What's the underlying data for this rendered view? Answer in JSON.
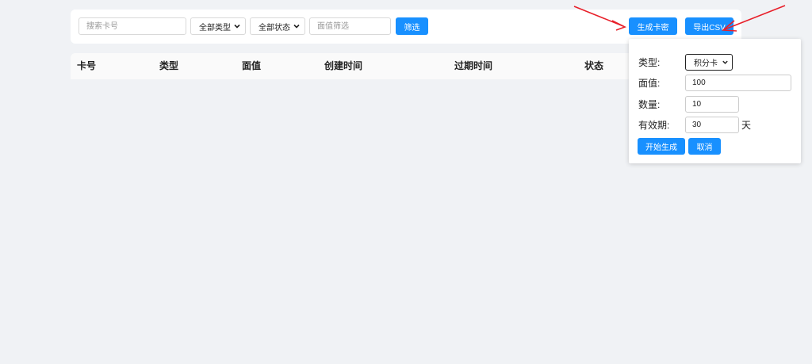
{
  "toolbar": {
    "search_placeholder": "搜索卡号",
    "type_select": "全部类型",
    "status_select": "全部状态",
    "value_placeholder": "面值筛选",
    "filter_button": "筛选",
    "generate_button": "生成卡密",
    "export_button": "导出CSV"
  },
  "table": {
    "columns": [
      "卡号",
      "类型",
      "面值",
      "创建时间",
      "过期时间",
      "状态"
    ]
  },
  "generate_panel": {
    "type_label": "类型:",
    "type_value": "积分卡",
    "value_label": "面值:",
    "value_value": "100",
    "quantity_label": "数量:",
    "quantity_value": "10",
    "validity_label": "有效期:",
    "validity_value": "30",
    "validity_unit": "天",
    "start_button": "开始生成",
    "cancel_button": "取消"
  },
  "colors": {
    "primary": "#1890ff",
    "background": "#f0f2f5",
    "annotation_arrow": "#e8202a"
  },
  "icons": {
    "dropdown": "chevron-down-icon",
    "annotation": "arrow-annotation-icon"
  }
}
